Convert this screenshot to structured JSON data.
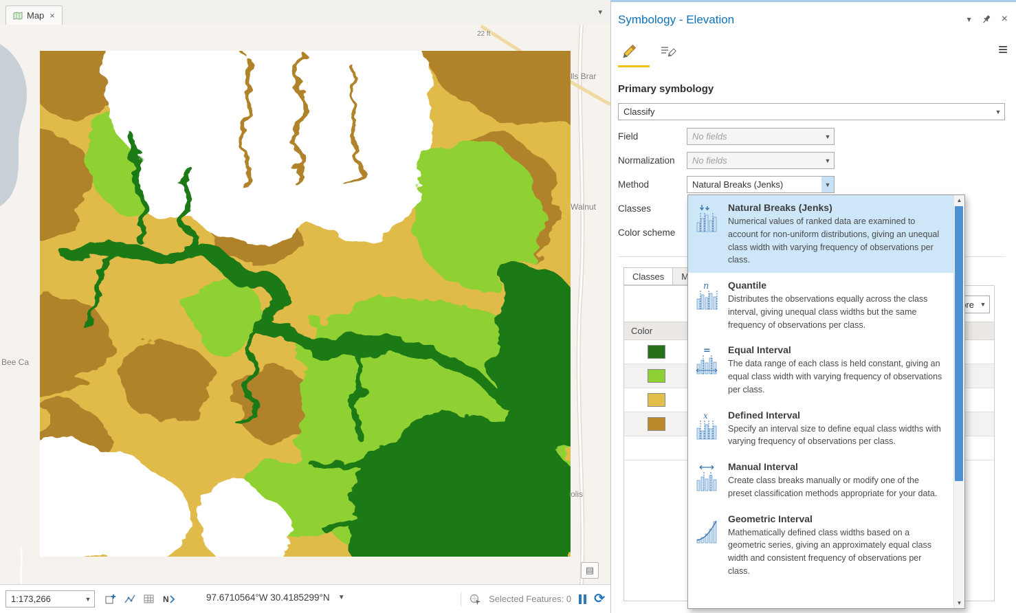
{
  "map_panel": {
    "tab": {
      "label": "Map"
    },
    "basemap_labels": {
      "falls_branch": "lls Brar",
      "walnut": "Walnut",
      "bee_cave": "Bee Ca",
      "olis": "olis",
      "elevation_note": "22 ft"
    },
    "raster_colors": {
      "white": "#ffffff",
      "yellow": "#E1BB49",
      "brown": "#B0832B",
      "light_green": "#8FD133",
      "dark_green": "#1E7A16"
    },
    "status_bar": {
      "scale": "1:173,266",
      "coordinates": "97.6710564°W 30.4185299°N",
      "selected_features_label": "Selected Features:",
      "selected_features_count": "0"
    }
  },
  "symbology_panel": {
    "title": "Symbology - Elevation",
    "primary_symbology_label": "Primary symbology",
    "renderer": "Classify",
    "rows": [
      {
        "label": "Field",
        "value": "No fields"
      },
      {
        "label": "Normalization",
        "value": "No fields"
      },
      {
        "label": "Method",
        "value": "Natural Breaks (Jenks)"
      },
      {
        "label": "Classes"
      },
      {
        "label": "Color scheme"
      }
    ],
    "tabs": [
      {
        "label": "Classes"
      },
      {
        "label": "Mas"
      }
    ],
    "table": {
      "color_header": "Color",
      "more_label": "More",
      "swatches": [
        "#267019",
        "#8CD033",
        "#E2BE4B",
        "#BA8A2A"
      ]
    }
  },
  "method_popup": {
    "items": [
      {
        "icon": "natural-breaks-icon",
        "title": "Natural Breaks (Jenks)",
        "description": "Numerical values of ranked data are examined to account for non-uniform distributions, giving an unequal class width with varying frequency of observations per class."
      },
      {
        "icon": "quantile-icon",
        "title": "Quantile",
        "description": "Distributes the observations equally across the class interval, giving unequal class widths but the same frequency of observations per class."
      },
      {
        "icon": "equal-interval-icon",
        "title": "Equal Interval",
        "description": "The data range of each class is held constant, giving an equal class width with varying frequency of observations per class."
      },
      {
        "icon": "defined-interval-icon",
        "title": "Defined Interval",
        "description": "Specify an interval size to define equal class widths with varying frequency of observations per class."
      },
      {
        "icon": "manual-interval-icon",
        "title": "Manual Interval",
        "description": "Create class breaks manually or modify one of the preset classification methods appropriate for your data."
      },
      {
        "icon": "geometric-interval-icon",
        "title": "Geometric Interval",
        "description": "Mathematically defined class widths based on a geometric series, giving an approximately equal class width and consistent frequency of observations per class."
      }
    ]
  }
}
